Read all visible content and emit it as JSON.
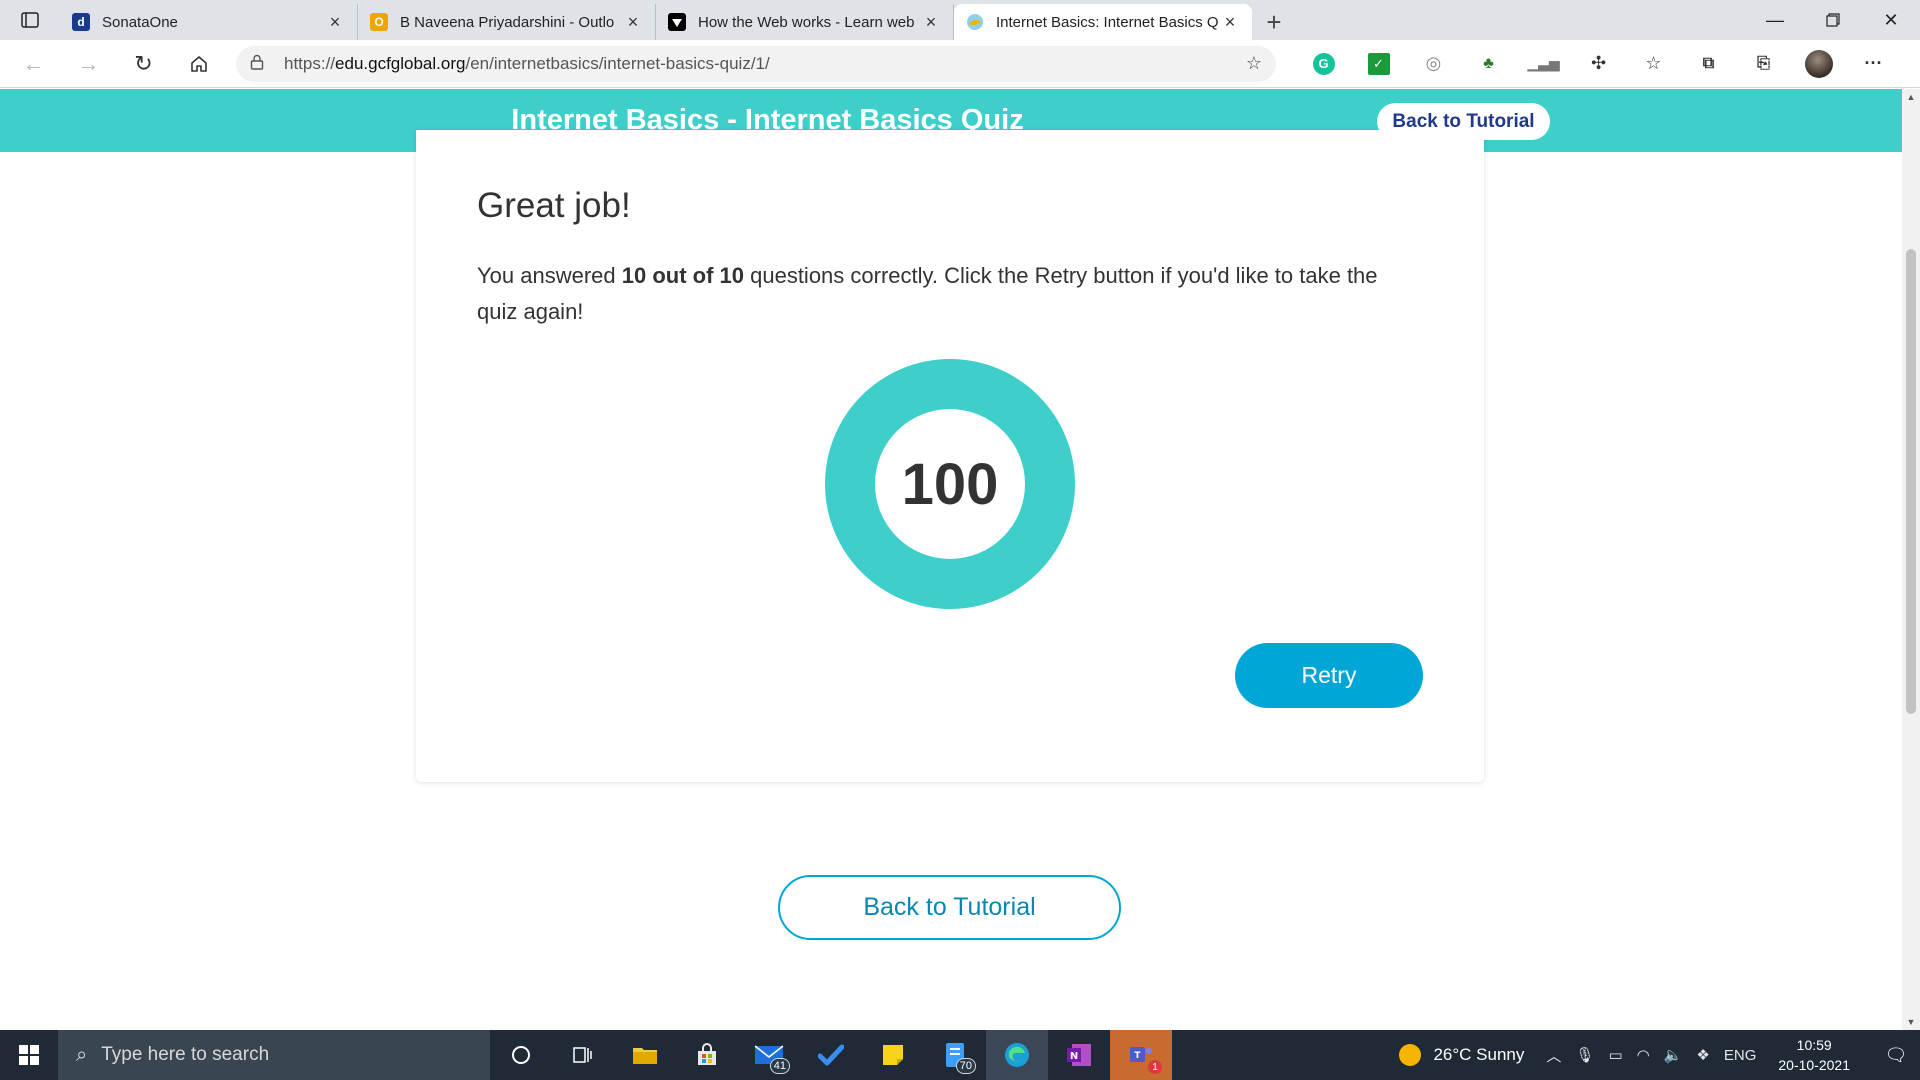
{
  "browser": {
    "tabs": [
      {
        "title": "SonataOne",
        "favicon": "d",
        "favicon_color": "#1a3a8a",
        "active": false
      },
      {
        "title": "B Naveena Priyadarshini - Outlo",
        "favicon": "O",
        "favicon_color": "#f0a400",
        "active": false
      },
      {
        "title": "How the Web works - Learn web",
        "favicon": "mdn-icon",
        "favicon_color": "#000000",
        "active": false
      },
      {
        "title": "Internet Basics: Internet Basics Q",
        "favicon": "gcf-icon",
        "favicon_color": "#3aa0d8",
        "active": true
      }
    ],
    "url_prefix": "https://",
    "url_domain": "edu.gcfglobal.org",
    "url_path": "/en/internetbasics/internet-basics-quiz/1/"
  },
  "header": {
    "course_link": "Internet Basics",
    "separator": "-",
    "quiz_title": "Internet Basics Quiz",
    "back_button": "Back to Tutorial",
    "color": "#3ecfca"
  },
  "result": {
    "heading": "Great job!",
    "msg_before": "You answered ",
    "msg_bold": "10 out of 10",
    "msg_after": " questions correctly. Click the Retry button if you'd like to take the quiz again!",
    "score": "100",
    "retry_label": "Retry"
  },
  "footer": {
    "back_label": "Back to Tutorial"
  },
  "taskbar": {
    "search_placeholder": "Type here to search",
    "mail_badge": "41",
    "files_badge": "70",
    "teams_badge": "1",
    "weather": "26°C  Sunny",
    "language": "ENG",
    "time": "10:59",
    "date": "20-10-2021"
  }
}
